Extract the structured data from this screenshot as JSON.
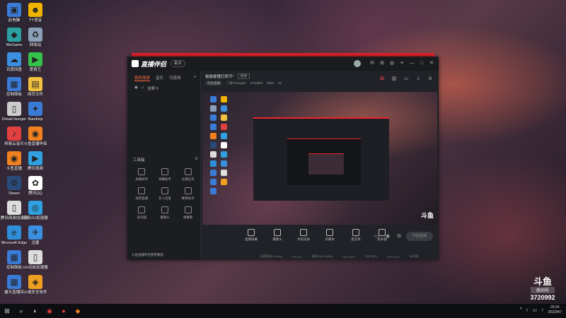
{
  "desktop": {
    "icons": [
      {
        "label": "此电脑",
        "color": "#3a7bd5",
        "glyph": "▣"
      },
      {
        "label": "YY语音",
        "color": "#f0b400",
        "glyph": "☻"
      },
      {
        "label": "WeGame",
        "color": "#2aa0a0",
        "glyph": "◆"
      },
      {
        "label": "回收站",
        "color": "#8aa0b8",
        "glyph": "♻"
      },
      {
        "label": "百度网盘",
        "color": "#3a8fe0",
        "glyph": "☁"
      },
      {
        "label": "爱奇艺",
        "color": "#35c24a",
        "glyph": "▶"
      },
      {
        "label": "控制面板",
        "color": "#3a7bd5",
        "glyph": "▦"
      },
      {
        "label": "网页文件",
        "color": "#f0c040",
        "glyph": "▤"
      },
      {
        "label": "Dread Hunger",
        "color": "#cccccc",
        "glyph": "▯"
      },
      {
        "label": "Bandizip",
        "color": "#3a7bd5",
        "glyph": "✦"
      },
      {
        "label": "网易云音乐",
        "color": "#e04040",
        "glyph": "♪"
      },
      {
        "label": "斗鱼直播伴侣",
        "color": "#f08020",
        "glyph": "◉"
      },
      {
        "label": "斗鱼直播",
        "color": "#f08020",
        "glyph": "◉"
      },
      {
        "label": "腾讯视频",
        "color": "#30a0e0",
        "glyph": "▶"
      },
      {
        "label": "Steam",
        "color": "#2a4a7a",
        "glyph": "⚙"
      },
      {
        "label": "腾讯QQ",
        "color": "#ffffff",
        "glyph": "✿"
      },
      {
        "label": "腾讯网游加速器",
        "color": "#dddddd",
        "glyph": "▯"
      },
      {
        "label": "网易UU加速器",
        "color": "#30a0e0",
        "glyph": "◎"
      },
      {
        "label": "Microsoft Edge",
        "color": "#2e8fd8",
        "glyph": "e"
      },
      {
        "label": "迅雷",
        "color": "#3a8fe0",
        "glyph": "✈"
      },
      {
        "label": "控制面板",
        "color": "#3a7bd5",
        "glyph": "▦"
      },
      {
        "label": "UU动态加速器",
        "color": "#dddddd",
        "glyph": "▯"
      },
      {
        "label": "露天直播间",
        "color": "#3a7bd5",
        "glyph": "▦"
      },
      {
        "label": "火绒安全软件",
        "color": "#f0a020",
        "glyph": "◈"
      }
    ]
  },
  "window": {
    "app_name": "直播伴侣",
    "badge": "副本",
    "sidebar": {
      "tabs": [
        "我的场景",
        "音乐",
        "可道场"
      ],
      "scene": "全屏 5",
      "tools_title": "工具箱",
      "tools": [
        "屏幕助手",
        "弹幕助手",
        "主播任务",
        "视频直播",
        "多人连麦",
        "赛事助手",
        "房间器",
        "摄像头",
        "弹幕看"
      ],
      "footer": "斗鱼直播伴侣使用教程"
    },
    "room": {
      "title": "偷偷偷懂打防守!",
      "chip": "修改",
      "category": "综合直播",
      "meta": [
        "二级Trevagnk",
        "3720992",
        "5831",
        "62"
      ]
    },
    "controls": [
      "直播屏幕",
      "摄像头",
      "手机投屏",
      "多媒体",
      "麦克风",
      "扬声器"
    ],
    "start_label": "开始直播",
    "status": [
      "直播质量:Fluency",
      "FPS:30",
      "带宽:000.00KB/s",
      "CPU:40%",
      "内存:56%",
      "GPU:22%",
      "未开播"
    ],
    "preview_watermark": "斗鱼"
  },
  "taskbar": {
    "clock_time": "20:24",
    "clock_date": "2022/4/7"
  },
  "overlay": {
    "brand": "斗鱼",
    "sub": "房间号",
    "room_number": "3720992"
  }
}
